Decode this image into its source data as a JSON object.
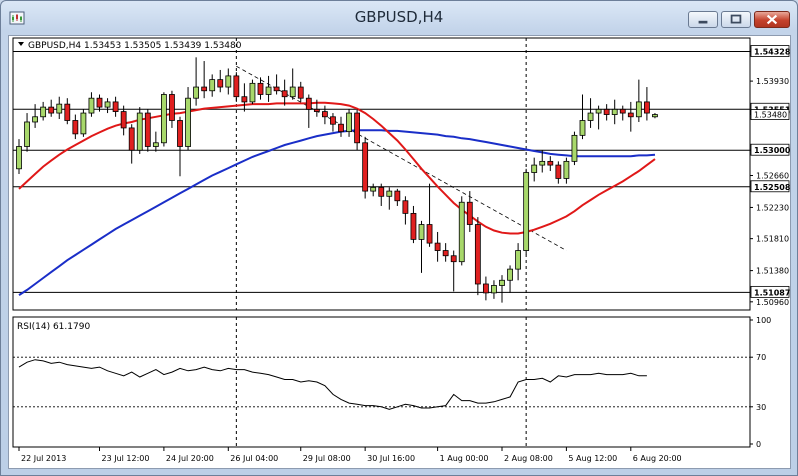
{
  "window": {
    "title": "GBPUSD,H4"
  },
  "chart_data": [
    {
      "type": "candlestick",
      "symbol_header": "GBPUSD,H4  1.53453 1.53505 1.53439 1.53480",
      "price_ticks": [
        "1.54328",
        "1.53930",
        "1.53480",
        "1.53000",
        "1.52660",
        "1.52230",
        "1.51810",
        "1.51380",
        "1.50960"
      ],
      "price_tick_values": [
        1.54328,
        1.5393,
        1.5348,
        1.53,
        1.5266,
        1.5223,
        1.5181,
        1.5138,
        1.5096
      ],
      "ylim": [
        1.5085,
        1.5451
      ],
      "hlines": [
        {
          "label": "1.54328",
          "value": 1.54328,
          "highlight": false
        },
        {
          "label": "1.53551",
          "value": 1.53551,
          "highlight": false
        },
        {
          "label": "1.53000",
          "value": 1.53,
          "highlight": true
        },
        {
          "label": "1.52508",
          "value": 1.52508,
          "highlight": false
        },
        {
          "label": "1.51087",
          "value": 1.51087,
          "highlight": false
        }
      ],
      "bid_label": "1.53480",
      "bid_value": 1.5348,
      "candles": [
        [
          1.5275,
          1.5315,
          1.5268,
          1.5305
        ],
        [
          1.5305,
          1.535,
          1.5298,
          1.5338
        ],
        [
          1.5338,
          1.5362,
          1.533,
          1.5345
        ],
        [
          1.5345,
          1.5365,
          1.534,
          1.5358
        ],
        [
          1.5358,
          1.5368,
          1.5345,
          1.535
        ],
        [
          1.535,
          1.5372,
          1.5342,
          1.5362
        ],
        [
          1.5362,
          1.537,
          1.5335,
          1.534
        ],
        [
          1.534,
          1.5348,
          1.5315,
          1.5322
        ],
        [
          1.5322,
          1.5355,
          1.5318,
          1.535
        ],
        [
          1.535,
          1.5378,
          1.5345,
          1.537
        ],
        [
          1.537,
          1.5375,
          1.5352,
          1.5358
        ],
        [
          1.5358,
          1.537,
          1.535,
          1.5365
        ],
        [
          1.5365,
          1.5372,
          1.5345,
          1.5352
        ],
        [
          1.5352,
          1.536,
          1.532,
          1.533
        ],
        [
          1.533,
          1.5335,
          1.5282,
          1.53
        ],
        [
          1.53,
          1.5358,
          1.5295,
          1.535
        ],
        [
          1.535,
          1.5355,
          1.5298,
          1.5305
        ],
        [
          1.5305,
          1.5325,
          1.5298,
          1.531
        ],
        [
          1.531,
          1.5378,
          1.5305,
          1.5375
        ],
        [
          1.5375,
          1.538,
          1.533,
          1.534
        ],
        [
          1.534,
          1.5345,
          1.5265,
          1.5305
        ],
        [
          1.5305,
          1.5385,
          1.53,
          1.537
        ],
        [
          1.537,
          1.5425,
          1.536,
          1.5385
        ],
        [
          1.5385,
          1.542,
          1.537,
          1.538
        ],
        [
          1.538,
          1.5402,
          1.5372,
          1.5395
        ],
        [
          1.5395,
          1.5408,
          1.5378,
          1.5385
        ],
        [
          1.5385,
          1.541,
          1.5375,
          1.54
        ],
        [
          1.54,
          1.5405,
          1.5365,
          1.5372
        ],
        [
          1.5372,
          1.539,
          1.5352,
          1.5365
        ],
        [
          1.5365,
          1.5395,
          1.5362,
          1.539
        ],
        [
          1.539,
          1.5398,
          1.5368,
          1.5375
        ],
        [
          1.5375,
          1.54,
          1.5365,
          1.5385
        ],
        [
          1.5385,
          1.5402,
          1.5375,
          1.538
        ],
        [
          1.538,
          1.5395,
          1.536,
          1.5372
        ],
        [
          1.5372,
          1.541,
          1.5368,
          1.5385
        ],
        [
          1.5385,
          1.5392,
          1.5365,
          1.537
        ],
        [
          1.537,
          1.5375,
          1.533,
          1.5355
        ],
        [
          1.5355,
          1.5368,
          1.5345,
          1.5352
        ],
        [
          1.5352,
          1.536,
          1.5335,
          1.5345
        ],
        [
          1.5345,
          1.535,
          1.5325,
          1.5335
        ],
        [
          1.5335,
          1.5345,
          1.5318,
          1.5325
        ],
        [
          1.5325,
          1.5355,
          1.5318,
          1.535
        ],
        [
          1.535,
          1.5355,
          1.53,
          1.531
        ],
        [
          1.531,
          1.5318,
          1.5235,
          1.5245
        ],
        [
          1.5245,
          1.5255,
          1.5238,
          1.525
        ],
        [
          1.525,
          1.5255,
          1.5225,
          1.5238
        ],
        [
          1.5238,
          1.525,
          1.522,
          1.5245
        ],
        [
          1.5245,
          1.5248,
          1.5225,
          1.5232
        ],
        [
          1.5232,
          1.5238,
          1.52,
          1.5215
        ],
        [
          1.5215,
          1.5225,
          1.5175,
          1.518
        ],
        [
          1.518,
          1.5205,
          1.5135,
          1.52
        ],
        [
          1.52,
          1.5255,
          1.517,
          1.5175
        ],
        [
          1.5175,
          1.519,
          1.515,
          1.5165
        ],
        [
          1.5165,
          1.5175,
          1.515,
          1.5158
        ],
        [
          1.5158,
          1.5165,
          1.511,
          1.515
        ],
        [
          1.515,
          1.5238,
          1.5145,
          1.523
        ],
        [
          1.523,
          1.5245,
          1.519,
          1.52
        ],
        [
          1.52,
          1.521,
          1.5105,
          1.512
        ],
        [
          1.512,
          1.513,
          1.5098,
          1.5108
        ],
        [
          1.5108,
          1.5125,
          1.51,
          1.5118
        ],
        [
          1.5118,
          1.5132,
          1.5095,
          1.5125
        ],
        [
          1.5125,
          1.5145,
          1.5108,
          1.514
        ],
        [
          1.514,
          1.5175,
          1.5125,
          1.5165
        ],
        [
          1.5165,
          1.5275,
          1.516,
          1.527
        ],
        [
          1.527,
          1.529,
          1.5258,
          1.528
        ],
        [
          1.528,
          1.53,
          1.527,
          1.5285
        ],
        [
          1.5285,
          1.5292,
          1.5272,
          1.528
        ],
        [
          1.528,
          1.5285,
          1.5255,
          1.5262
        ],
        [
          1.5262,
          1.529,
          1.5255,
          1.5285
        ],
        [
          1.5285,
          1.5325,
          1.528,
          1.532
        ],
        [
          1.532,
          1.5375,
          1.5315,
          1.534
        ],
        [
          1.534,
          1.537,
          1.533,
          1.535
        ],
        [
          1.535,
          1.536,
          1.5328,
          1.5355
        ],
        [
          1.5355,
          1.5362,
          1.534,
          1.5348
        ],
        [
          1.5348,
          1.5368,
          1.5335,
          1.5355
        ],
        [
          1.5355,
          1.536,
          1.534,
          1.535
        ],
        [
          1.535,
          1.5365,
          1.5325,
          1.5345
        ],
        [
          1.5345,
          1.5395,
          1.5338,
          1.5365
        ],
        [
          1.5365,
          1.5385,
          1.534,
          1.535
        ],
        [
          1.5345,
          1.535,
          1.5343,
          1.5348
        ]
      ],
      "ma_fast": [
        1.5248,
        1.5258,
        1.5268,
        1.5278,
        1.5286,
        1.5294,
        1.5301,
        1.5307,
        1.5313,
        1.5319,
        1.5324,
        1.5329,
        1.5333,
        1.5336,
        1.5338,
        1.5341,
        1.5343,
        1.5345,
        1.5347,
        1.5349,
        1.535,
        1.5352,
        1.5354,
        1.5356,
        1.5357,
        1.5358,
        1.5359,
        1.536,
        1.5361,
        1.5362,
        1.5362,
        1.5362,
        1.5363,
        1.5363,
        1.5363,
        1.5363,
        1.5363,
        1.5364,
        1.5364,
        1.5363,
        1.5362,
        1.536,
        1.5356,
        1.535,
        1.5342,
        1.5333,
        1.5323,
        1.5313,
        1.5301,
        1.5288,
        1.5275,
        1.5263,
        1.5251,
        1.524,
        1.5229,
        1.522,
        1.5212,
        1.5204,
        1.5197,
        1.5192,
        1.5189,
        1.5188,
        1.5188,
        1.519,
        1.5193,
        1.5197,
        1.5201,
        1.5206,
        1.5211,
        1.5218,
        1.5226,
        1.5233,
        1.524,
        1.5246,
        1.5252,
        1.5258,
        1.5265,
        1.5272,
        1.528,
        1.5288
      ],
      "ma_slow": [
        1.5105,
        1.5112,
        1.512,
        1.5128,
        1.5136,
        1.5144,
        1.5152,
        1.5159,
        1.5166,
        1.5173,
        1.518,
        1.5187,
        1.5194,
        1.52,
        1.5206,
        1.5212,
        1.5218,
        1.5224,
        1.523,
        1.5236,
        1.5242,
        1.5248,
        1.5254,
        1.526,
        1.5266,
        1.5271,
        1.5276,
        1.5281,
        1.5286,
        1.5291,
        1.5295,
        1.5299,
        1.5303,
        1.5307,
        1.531,
        1.5313,
        1.5316,
        1.5319,
        1.5321,
        1.5323,
        1.5325,
        1.5326,
        1.5327,
        1.5327,
        1.5327,
        1.5327,
        1.5326,
        1.5326,
        1.5325,
        1.5324,
        1.5323,
        1.5322,
        1.5321,
        1.5319,
        1.5318,
        1.5316,
        1.5315,
        1.5313,
        1.5311,
        1.5309,
        1.5307,
        1.5305,
        1.5303,
        1.5301,
        1.5299,
        1.5297,
        1.5295,
        1.5294,
        1.5293,
        1.5292,
        1.5292,
        1.5292,
        1.5292,
        1.5292,
        1.5292,
        1.5292,
        1.5292,
        1.5293,
        1.5293,
        1.5294
      ],
      "trendline": {
        "start": [
          27,
          1.5413
        ],
        "end": [
          68,
          1.5165
        ]
      },
      "vlines": [
        27,
        63
      ],
      "x_labels": [
        {
          "label": "22 Jul 2013",
          "i": 0
        },
        {
          "label": "23 Jul 12:00",
          "i": 10
        },
        {
          "label": "24 Jul 20:00",
          "i": 18
        },
        {
          "label": "26 Jul 04:00",
          "i": 26
        },
        {
          "label": "29 Jul 08:00",
          "i": 35
        },
        {
          "label": "30 Jul 16:00",
          "i": 43
        },
        {
          "label": "1 Aug 00:00",
          "i": 52
        },
        {
          "label": "2 Aug 08:00",
          "i": 60
        },
        {
          "label": "5 Aug 12:00",
          "i": 68
        },
        {
          "label": "6 Aug 20:00",
          "i": 76
        }
      ]
    },
    {
      "type": "line",
      "header": "RSI(14) 61.1790",
      "y_ticks": [
        100,
        70,
        30,
        0
      ],
      "levels": [
        70,
        30
      ],
      "ylim": [
        0,
        100
      ],
      "values": [
        62,
        66,
        68,
        67,
        65,
        66,
        64,
        63,
        62,
        61,
        62,
        59,
        57,
        55,
        58,
        54,
        57,
        60,
        56,
        58,
        61,
        59,
        60,
        62,
        60,
        59,
        61,
        60,
        60,
        58,
        57,
        56,
        54,
        52,
        52,
        50,
        51,
        50,
        47,
        40,
        36,
        33,
        32,
        31,
        31,
        30,
        28,
        30,
        32,
        31,
        29,
        29,
        30,
        31,
        40,
        35,
        35,
        33,
        33,
        34,
        36,
        38,
        50,
        52,
        52,
        53,
        50,
        55,
        54,
        56,
        56,
        56,
        57,
        56,
        56,
        56,
        57,
        55,
        55
      ]
    }
  ]
}
